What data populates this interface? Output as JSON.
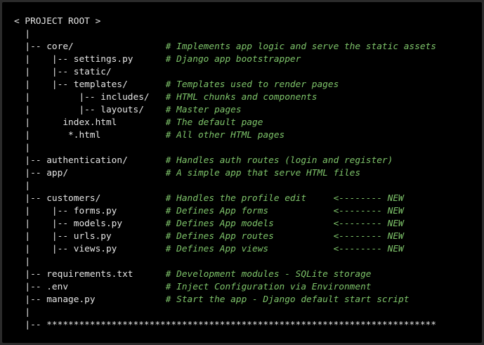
{
  "code_block": {
    "lines": [
      {
        "tree": "< PROJECT ROOT >",
        "comment": ""
      },
      {
        "tree": "  |",
        "comment": ""
      },
      {
        "tree": "  |-- core/                 ",
        "comment": "# Implements app logic and serve the static assets"
      },
      {
        "tree": "  |    |-- settings.py      ",
        "comment": "# Django app bootstrapper"
      },
      {
        "tree": "  |    |-- static/",
        "comment": ""
      },
      {
        "tree": "  |    |-- templates/       ",
        "comment": "# Templates used to render pages"
      },
      {
        "tree": "  |         |-- includes/   ",
        "comment": "# HTML chunks and components"
      },
      {
        "tree": "  |         |-- layouts/    ",
        "comment": "# Master pages"
      },
      {
        "tree": "  |      index.html         ",
        "comment": "# The default page"
      },
      {
        "tree": "  |       *.html            ",
        "comment": "# All other HTML pages"
      },
      {
        "tree": "  |",
        "comment": ""
      },
      {
        "tree": "  |-- authentication/       ",
        "comment": "# Handles auth routes (login and register)"
      },
      {
        "tree": "  |-- app/                  ",
        "comment": "# A simple app that serve HTML files"
      },
      {
        "tree": "  |",
        "comment": ""
      },
      {
        "tree": "  |-- customers/            ",
        "comment": "# Handles the profile edit     <-------- NEW"
      },
      {
        "tree": "  |    |-- forms.py         ",
        "comment": "# Defines App forms            <-------- NEW"
      },
      {
        "tree": "  |    |-- models.py        ",
        "comment": "# Defines App models           <-------- NEW"
      },
      {
        "tree": "  |    |-- urls.py          ",
        "comment": "# Defines App routes           <-------- NEW"
      },
      {
        "tree": "  |    |-- views.py         ",
        "comment": "# Defines App views            <-------- NEW"
      },
      {
        "tree": "  |",
        "comment": ""
      },
      {
        "tree": "  |-- requirements.txt      ",
        "comment": "# Development modules - SQLite storage"
      },
      {
        "tree": "  |-- .env                  ",
        "comment": "# Inject Configuration via Environment"
      },
      {
        "tree": "  |-- manage.py             ",
        "comment": "# Start the app - Django default start script"
      },
      {
        "tree": "  |",
        "comment": ""
      },
      {
        "tree": "  |-- ************************************************************************",
        "comment": ""
      }
    ]
  },
  "colors": {
    "background": "#000000",
    "text": "#e6e6e6",
    "comment": "#7ec46a"
  }
}
